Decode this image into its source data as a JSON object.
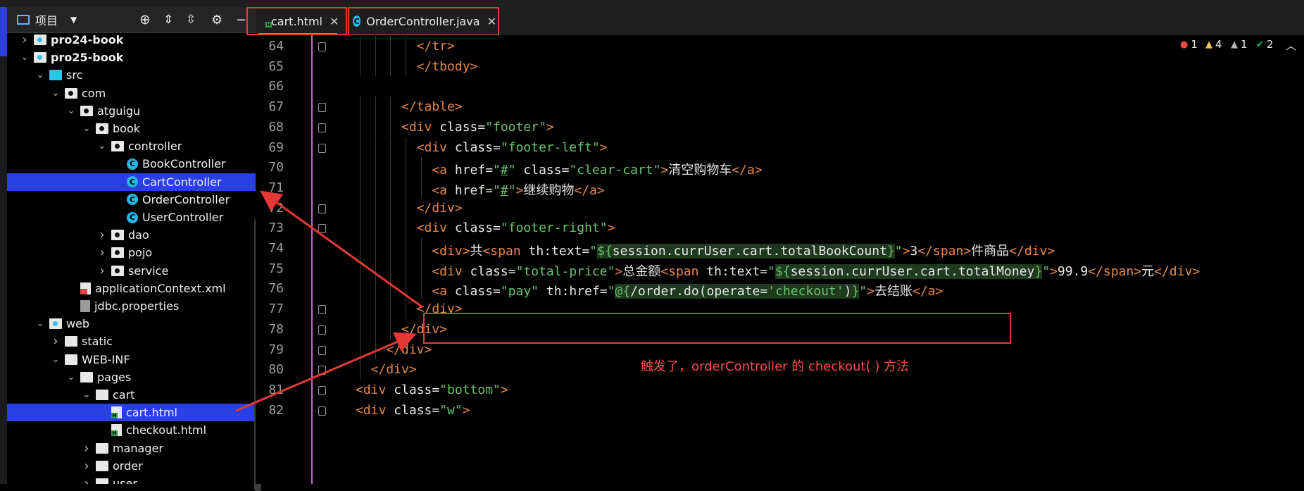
{
  "panel": {
    "title": "项目"
  },
  "tree": [
    {
      "label": "pro24-book",
      "type": "folder-web",
      "depth": 1,
      "chev": "right",
      "bold": true
    },
    {
      "label": "pro25-book",
      "type": "folder-web",
      "depth": 1,
      "chev": "down",
      "bold": true
    },
    {
      "label": "src",
      "type": "folder-src",
      "depth": 2,
      "chev": "down"
    },
    {
      "label": "com",
      "type": "folder-pkg",
      "depth": 3,
      "chev": "down"
    },
    {
      "label": "atguigu",
      "type": "folder-pkg",
      "depth": 4,
      "chev": "down"
    },
    {
      "label": "book",
      "type": "folder-pkg",
      "depth": 5,
      "chev": "down"
    },
    {
      "label": "controller",
      "type": "folder-pkg",
      "depth": 6,
      "chev": "down"
    },
    {
      "label": "BookController",
      "type": "class",
      "depth": 7,
      "chev": ""
    },
    {
      "label": "CartController",
      "type": "class",
      "depth": 7,
      "chev": "",
      "selected": true
    },
    {
      "label": "OrderController",
      "type": "class",
      "depth": 7,
      "chev": ""
    },
    {
      "label": "UserController",
      "type": "class",
      "depth": 7,
      "chev": ""
    },
    {
      "label": "dao",
      "type": "folder-pkg",
      "depth": 6,
      "chev": "right"
    },
    {
      "label": "pojo",
      "type": "folder-pkg",
      "depth": 6,
      "chev": "right"
    },
    {
      "label": "service",
      "type": "folder-pkg",
      "depth": 6,
      "chev": "right"
    },
    {
      "label": "applicationContext.xml",
      "type": "xml",
      "depth": 4,
      "chev": ""
    },
    {
      "label": "jdbc.properties",
      "type": "props",
      "depth": 4,
      "chev": ""
    },
    {
      "label": "web",
      "type": "folder-web",
      "depth": 2,
      "chev": "down"
    },
    {
      "label": "static",
      "type": "folder",
      "depth": 3,
      "chev": "right"
    },
    {
      "label": "WEB-INF",
      "type": "folder",
      "depth": 3,
      "chev": "down"
    },
    {
      "label": "pages",
      "type": "folder",
      "depth": 4,
      "chev": "down"
    },
    {
      "label": "cart",
      "type": "folder",
      "depth": 5,
      "chev": "down"
    },
    {
      "label": "cart.html",
      "type": "html",
      "depth": 6,
      "chev": "",
      "selected": true
    },
    {
      "label": "checkout.html",
      "type": "html",
      "depth": 6,
      "chev": ""
    },
    {
      "label": "manager",
      "type": "folder",
      "depth": 5,
      "chev": "right"
    },
    {
      "label": "order",
      "type": "folder",
      "depth": 5,
      "chev": "right"
    },
    {
      "label": "user",
      "type": "folder",
      "depth": 5,
      "chev": "right"
    }
  ],
  "tabs": [
    {
      "label": "cart.html",
      "active": true
    },
    {
      "label": "OrderController.java",
      "active": false
    }
  ],
  "inspections": [
    {
      "icon": "error-icon",
      "count": "1",
      "color": "#f44747"
    },
    {
      "icon": "warning-icon",
      "count": "4",
      "color": "#f2c55c"
    },
    {
      "icon": "weak-warning-icon",
      "count": "1",
      "color": "#b5b5b5"
    },
    {
      "icon": "check-icon",
      "count": "2",
      "color": "#3fbf5f"
    }
  ],
  "code_lines": [
    {
      "n": "64",
      "segs": [
        [
          "t",
          "</tr>"
        ]
      ]
    },
    {
      "n": "65",
      "segs": [
        [
          "t",
          "</tbody>"
        ]
      ]
    },
    {
      "n": "66",
      "segs": []
    },
    {
      "n": "67",
      "segs": [
        [
          "t",
          "</table>"
        ]
      ]
    },
    {
      "n": "68",
      "segs": [
        [
          "t",
          "<div "
        ],
        [
          "a",
          "class="
        ],
        [
          "s",
          "\"footer\""
        ],
        [
          "t",
          ">"
        ]
      ]
    },
    {
      "n": "69",
      "segs": [
        [
          "t",
          "<div "
        ],
        [
          "a",
          "class="
        ],
        [
          "s",
          "\"footer-left\""
        ],
        [
          "t",
          ">"
        ]
      ]
    },
    {
      "n": "70",
      "segs": [
        [
          "t",
          "<a "
        ],
        [
          "a",
          "href="
        ],
        [
          "s",
          "\""
        ],
        [
          "su",
          "#"
        ],
        [
          "s",
          "\""
        ],
        [
          "a",
          " class="
        ],
        [
          "s",
          "\"clear-cart\""
        ],
        [
          "t",
          ">"
        ],
        [
          "z",
          "清空购物车"
        ],
        [
          "t",
          "</a>"
        ]
      ]
    },
    {
      "n": "71",
      "segs": [
        [
          "t",
          "<a "
        ],
        [
          "a",
          "href="
        ],
        [
          "s",
          "\""
        ],
        [
          "su",
          "#"
        ],
        [
          "s",
          "\""
        ],
        [
          "t",
          ">"
        ],
        [
          "z",
          "继续购物"
        ],
        [
          "t",
          "</a>"
        ]
      ]
    },
    {
      "n": "72",
      "segs": [
        [
          "t",
          "</div>"
        ]
      ]
    },
    {
      "n": "73",
      "segs": [
        [
          "t",
          "<div "
        ],
        [
          "a",
          "class="
        ],
        [
          "s",
          "\"footer-right\""
        ],
        [
          "t",
          ">"
        ]
      ]
    },
    {
      "n": "74",
      "segs": [
        [
          "t",
          "<div>"
        ],
        [
          "z",
          "共"
        ],
        [
          "t",
          "<span "
        ],
        [
          "a",
          "th:text="
        ],
        [
          "s",
          "\""
        ],
        [
          "se",
          "${"
        ],
        [
          "ae",
          "session.currUser.cart.totalBookCount"
        ],
        [
          "se",
          "}"
        ],
        [
          "s",
          "\""
        ],
        [
          "t",
          ">"
        ],
        [
          "a",
          "3"
        ],
        [
          "t",
          "</span>"
        ],
        [
          "z",
          "件商品"
        ],
        [
          "t",
          "</div>"
        ]
      ]
    },
    {
      "n": "75",
      "segs": [
        [
          "t",
          "<div "
        ],
        [
          "a",
          "class="
        ],
        [
          "s",
          "\"total-price\""
        ],
        [
          "t",
          ">"
        ],
        [
          "z",
          "总金额"
        ],
        [
          "t",
          "<span "
        ],
        [
          "a",
          "th:text="
        ],
        [
          "s",
          "\""
        ],
        [
          "se",
          "${"
        ],
        [
          "ae",
          "session.currUser.cart.totalMoney"
        ],
        [
          "se",
          "}"
        ],
        [
          "s",
          "\""
        ],
        [
          "t",
          ">"
        ],
        [
          "a",
          "99.9"
        ],
        [
          "t",
          "</span>"
        ],
        [
          "z",
          "元"
        ],
        [
          "t",
          "</div>"
        ]
      ]
    },
    {
      "n": "76",
      "segs": [
        [
          "t",
          "<a "
        ],
        [
          "a",
          "class="
        ],
        [
          "s",
          "\"pay\""
        ],
        [
          "a",
          " th:href="
        ],
        [
          "s",
          "\""
        ],
        [
          "se",
          "@{"
        ],
        [
          "ae",
          "/order.do(operate="
        ],
        [
          "se",
          "'checkout'"
        ],
        [
          "ae",
          ")"
        ],
        [
          "se",
          "}"
        ],
        [
          "s",
          "\""
        ],
        [
          "t",
          ">"
        ],
        [
          "z",
          "去结账"
        ],
        [
          "t",
          "</a>"
        ]
      ]
    },
    {
      "n": "77",
      "segs": [
        [
          "t",
          "</div>"
        ]
      ]
    },
    {
      "n": "78",
      "segs": [
        [
          "t",
          "</div>"
        ]
      ]
    },
    {
      "n": "79",
      "segs": [
        [
          "t",
          "</div>"
        ]
      ]
    },
    {
      "n": "80",
      "segs": [
        [
          "t",
          "</div>"
        ]
      ]
    },
    {
      "n": "81",
      "segs": [
        [
          "t",
          "<div "
        ],
        [
          "a",
          "class="
        ],
        [
          "s",
          "\"bottom\""
        ],
        [
          "t",
          ">"
        ]
      ]
    },
    {
      "n": "82",
      "segs": [
        [
          "t",
          "<div "
        ],
        [
          "a",
          "class="
        ],
        [
          "s",
          "\"w\""
        ],
        [
          "t",
          ">"
        ]
      ]
    }
  ],
  "annotation": "触发了，orderController 的 checkout( ) 方法",
  "colors": {
    "accent": "#2a3fe6",
    "annotation": "#e53935",
    "tag": "#e5874a",
    "string": "#6bc46d"
  }
}
